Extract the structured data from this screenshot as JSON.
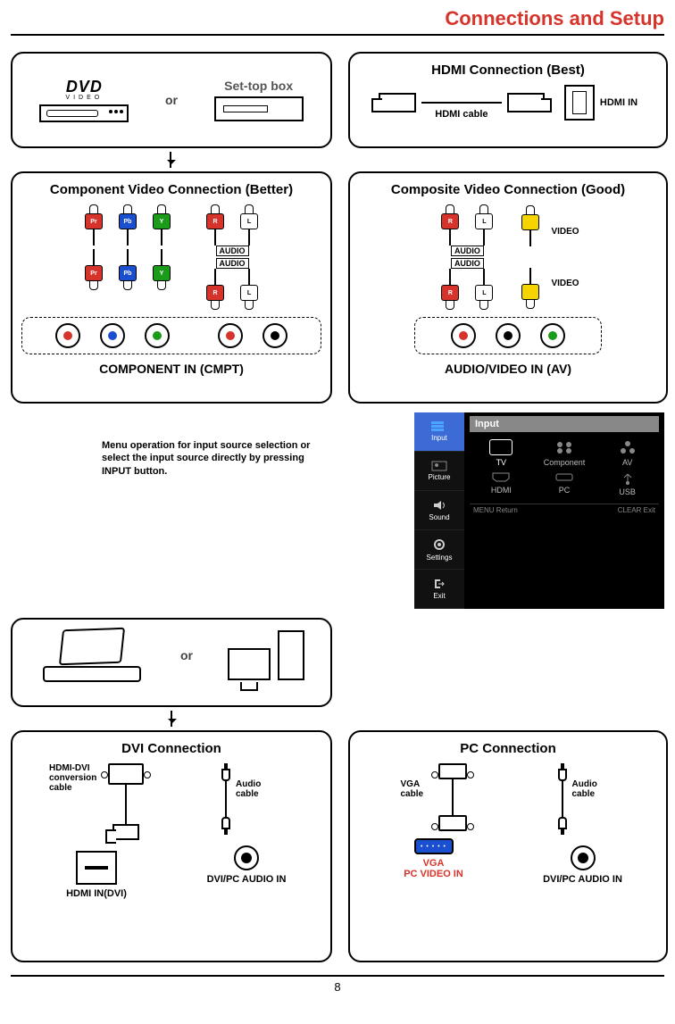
{
  "page": {
    "title": "Connections and Setup",
    "number": "8"
  },
  "source_box": {
    "dvd_logo": "DVD",
    "dvd_sub": "VIDEO",
    "or": "or",
    "stb": "Set-top box"
  },
  "hdmi": {
    "title": "HDMI Connection (Best)",
    "cable": "HDMI cable",
    "port": "HDMI IN"
  },
  "component": {
    "title": "Component Video Connection (Better)",
    "labels": {
      "pr": "Pr",
      "pb": "Pb",
      "y": "Y",
      "r": "R",
      "l": "L"
    },
    "audio": "AUDIO",
    "panel": "COMPONENT IN (CMPT)"
  },
  "composite": {
    "title": "Composite Video Connection (Good)",
    "labels": {
      "r": "R",
      "l": "L",
      "video": "VIDEO"
    },
    "audio": "AUDIO",
    "panel": "AUDIO/VIDEO IN (AV)"
  },
  "note": "Menu operation for input source selection or select the input source directly by pressing INPUT button.",
  "osd": {
    "header": "Input",
    "side": [
      "Input",
      "Picture",
      "Sound",
      "Settings",
      "Exit"
    ],
    "cells": [
      "TV",
      "Component",
      "AV",
      "HDMI",
      "PC",
      "USB"
    ],
    "foot_left": "Return",
    "foot_right": "Exit",
    "foot_menu": "MENU",
    "foot_clear": "CLEAR"
  },
  "pc_source": {
    "or": "or"
  },
  "dvi": {
    "title": "DVI Connection",
    "cable1": "HDMI-DVI conversion cable",
    "cable2": "Audio cable",
    "port1": "HDMI IN(DVI)",
    "port2": "DVI/PC AUDIO IN"
  },
  "pc": {
    "title": "PC Connection",
    "cable1": "VGA cable",
    "cable2": "Audio cable",
    "port1a": "VGA",
    "port1b": "PC VIDEO  IN",
    "port2": "DVI/PC AUDIO IN"
  }
}
